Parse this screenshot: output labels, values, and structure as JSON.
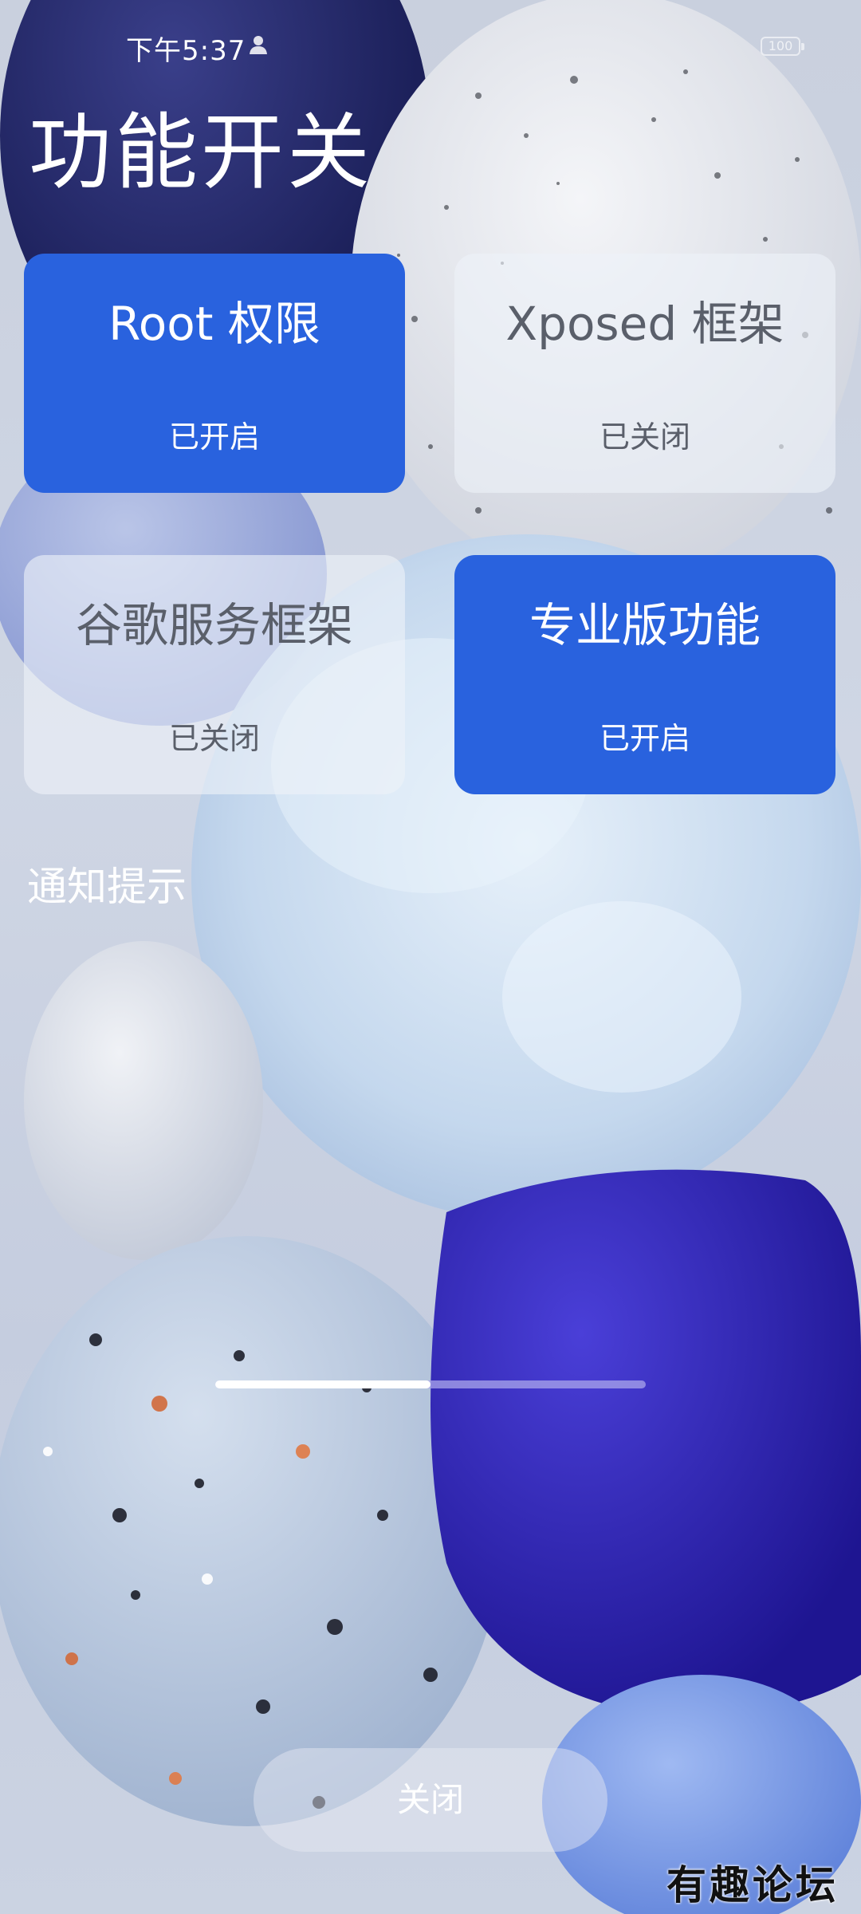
{
  "status_bar": {
    "time": "下午5:37",
    "battery": "100"
  },
  "page": {
    "title": "功能开关"
  },
  "tiles": [
    {
      "name": "Root 权限",
      "status": "已开启",
      "enabled": true
    },
    {
      "name": "Xposed 框架",
      "status": "已关闭",
      "enabled": false
    },
    {
      "name": "谷歌服务框架",
      "status": "已关闭",
      "enabled": false
    },
    {
      "name": "专业版功能",
      "status": "已开启",
      "enabled": true
    }
  ],
  "sections": {
    "notification_label": "通知提示"
  },
  "scroll_indicator": {
    "progress": 0.5
  },
  "actions": {
    "close_label": "关闭"
  },
  "watermark": "有趣论坛",
  "colors": {
    "tile_on": "#2962de",
    "tile_off": "#eef2f8",
    "title_text": "#ffffff"
  }
}
